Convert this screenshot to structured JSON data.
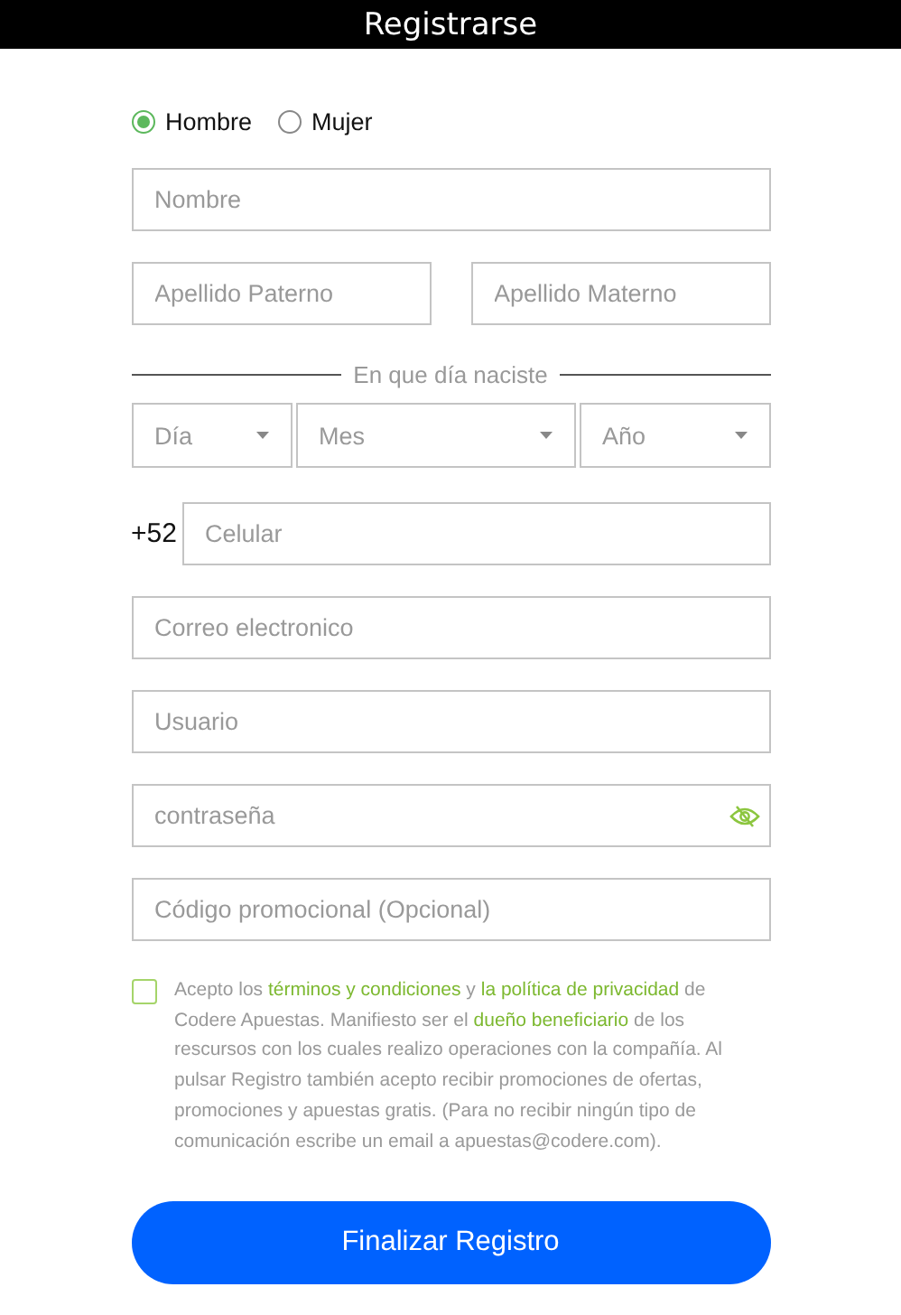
{
  "window": {
    "title": "Registrarse"
  },
  "gender": [
    {
      "label": "Hombre",
      "selected": true
    },
    {
      "label": "Mujer",
      "selected": false
    }
  ],
  "name_field": {
    "placeholder": "Nombre"
  },
  "surname_fields": [
    {
      "placeholder": "Apellido Paterno"
    },
    {
      "placeholder": "Apellido Materno"
    }
  ],
  "birth_section": {
    "label": "En que día naciste"
  },
  "birth_selects": [
    {
      "placeholder": "Día"
    },
    {
      "placeholder": "Mes"
    },
    {
      "placeholder": "Año"
    }
  ],
  "phone": {
    "prefix": "+52",
    "placeholder": "Celular"
  },
  "fields": [
    {
      "placeholder": "Correo electronico",
      "kind": "text"
    },
    {
      "placeholder": "Usuario",
      "kind": "text"
    },
    {
      "placeholder": "contraseña",
      "kind": "password"
    },
    {
      "placeholder": "Código promocional (Opcional)",
      "kind": "text"
    }
  ],
  "terms": {
    "checked": false,
    "segments": [
      {
        "kind": "text",
        "text": "Acepto los "
      },
      {
        "kind": "link",
        "text": "términos y condiciones"
      },
      {
        "kind": "text",
        "text": " y "
      },
      {
        "kind": "link",
        "text": "la política de privacidad"
      },
      {
        "kind": "text",
        "text": " de Codere Apuestas. Manifiesto ser el "
      },
      {
        "kind": "link",
        "text": "dueño beneficiario"
      },
      {
        "kind": "text",
        "text": " de los rescursos con los cuales realizo operaciones con la compañía. Al pulsar Registro también acepto recibir promociones de ofertas, promociones y apuestas gratis. (Para no recibir ningún tipo de comunicación escribe un email a apuestas@codere.com)."
      }
    ]
  },
  "submit": {
    "label": "Finalizar Registro"
  }
}
